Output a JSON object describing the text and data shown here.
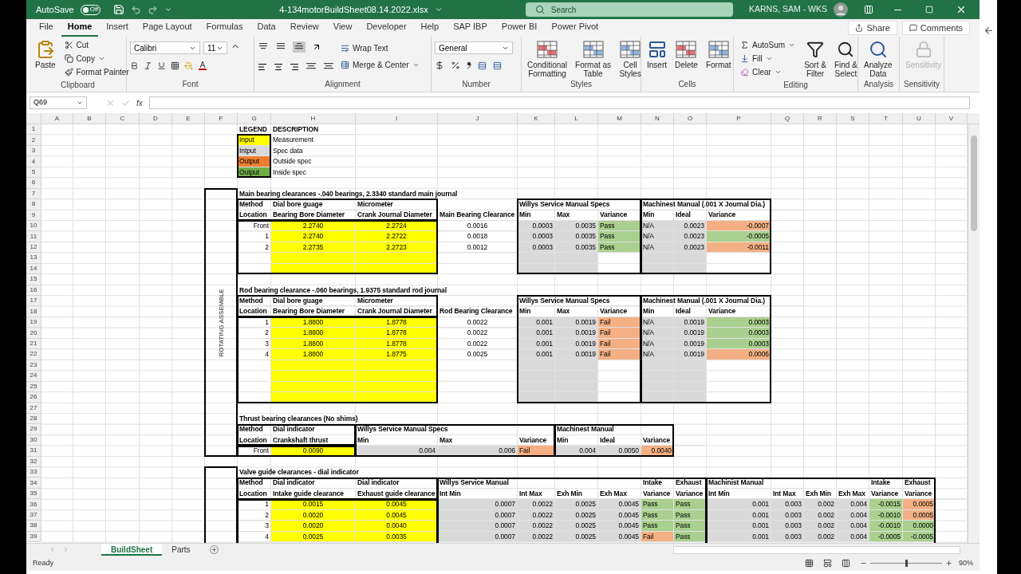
{
  "title_bar": {
    "autosave": {
      "label": "AutoSave",
      "on": false,
      "state_text": "Off"
    },
    "file_name": "4-134motorBuildSheet08.14.2022.xlsx",
    "search": {
      "placeholder": "Search"
    },
    "user": "KARNS, SAM - WKS"
  },
  "tabs": [
    {
      "label": "File",
      "selected": false
    },
    {
      "label": "Home",
      "selected": true
    },
    {
      "label": "Insert",
      "selected": false
    },
    {
      "label": "Page Layout",
      "selected": false
    },
    {
      "label": "Formulas",
      "selected": false
    },
    {
      "label": "Data",
      "selected": false
    },
    {
      "label": "Review",
      "selected": false
    },
    {
      "label": "View",
      "selected": false
    },
    {
      "label": "Developer",
      "selected": false
    },
    {
      "label": "Help",
      "selected": false
    },
    {
      "label": "SAP IBP",
      "selected": false
    },
    {
      "label": "Power BI",
      "selected": false
    },
    {
      "label": "Power Pivot",
      "selected": false
    }
  ],
  "share": "Share",
  "comments": "Comments",
  "ribbon": {
    "clipboard": {
      "label": "Clipboard",
      "paste": "Paste",
      "cut": "Cut",
      "copy": "Copy",
      "format_painter": "Format Painter"
    },
    "font": {
      "label": "Font",
      "font_name": "Calibri",
      "font_size": "11"
    },
    "alignment": {
      "label": "Alignment",
      "wrap_text": "Wrap Text",
      "merge_center": "Merge & Center"
    },
    "number": {
      "label": "Number",
      "format": "General"
    },
    "styles": {
      "label": "Styles",
      "conditional_formatting": "Conditional\nFormatting",
      "format_as_table": "Format as\nTable",
      "cell_styles": "Cell\nStyles"
    },
    "cells": {
      "label": "Cells",
      "insert": "Insert",
      "delete": "Delete",
      "format": "Format"
    },
    "editing": {
      "label": "Editing",
      "autosum": "AutoSum",
      "fill": "Fill",
      "clear": "Clear",
      "sort_filter": "Sort &\nFilter",
      "find_select": "Find &\nSelect"
    },
    "analysis": {
      "label": "Analysis",
      "analyze_data": "Analyze\nData"
    },
    "sensitivity": {
      "label": "Sensitivity",
      "button": {
        "label": "Sensitivity",
        "disabled": true
      }
    }
  },
  "formula_bar": {
    "name_box": "Q69",
    "fx": "fx"
  },
  "sheet": {
    "columns": [
      "A",
      "B",
      "C",
      "D",
      "E",
      "F",
      "G",
      "H",
      "I",
      "J",
      "K",
      "L",
      "M",
      "N",
      "O",
      "P",
      "Q",
      "R",
      "S",
      "T",
      "U",
      "V"
    ],
    "side_label": "ROTATING ASSEMBLE",
    "rows": [
      {
        "num": "1",
        "cells": [
          "",
          "",
          "",
          "",
          "",
          "",
          {
            "text": "LEGEND",
            "bold": true
          },
          {
            "text": "DESCRIPTION",
            "bold": true
          }
        ]
      },
      {
        "num": "2",
        "cells": [
          "",
          "",
          "",
          "",
          "",
          "",
          {
            "text": "Input",
            "color": "#ffff00"
          },
          {
            "text": "Measurement"
          }
        ]
      },
      {
        "num": "3",
        "cells": [
          "",
          "",
          "",
          "",
          "",
          "",
          {
            "text": "Intput",
            "color": "#d9d9d9"
          },
          {
            "text": "Spec data"
          }
        ]
      },
      {
        "num": "4",
        "cells": [
          "",
          "",
          "",
          "",
          "",
          "",
          {
            "text": "Output",
            "color": "#ed7d31"
          },
          {
            "text": "Outside spec"
          }
        ]
      },
      {
        "num": "5",
        "cells": [
          "",
          "",
          "",
          "",
          "",
          "",
          {
            "text": "Output",
            "color": "#70ad47"
          },
          {
            "text": "Inside spec"
          }
        ]
      },
      {
        "num": "6",
        "cells": []
      },
      {
        "num": "7",
        "cells": [
          "",
          "",
          "",
          "",
          "",
          "",
          {
            "text": "Main bearing clearances -.040 bearings, 2.3340 standard main journal",
            "bold": true
          }
        ]
      },
      {
        "num": "8",
        "cells": [
          "",
          "",
          "",
          "",
          "",
          "",
          {
            "text": "Method",
            "bold": true
          },
          {
            "text": "Dial bore guage",
            "bold": true
          },
          {
            "text": "Micrometer",
            "bold": true
          },
          "",
          {
            "text": "Willys Service Manual Specs",
            "bold": true
          },
          "",
          "",
          {
            "text": "Machinest Manual (.001 X Journal Dia.)",
            "bold": true
          }
        ]
      },
      {
        "num": "9",
        "cells": [
          "",
          "",
          "",
          "",
          "",
          "",
          {
            "text": "Location",
            "bold": true
          },
          {
            "text": "Bearing Bore Diameter",
            "bold": true
          },
          {
            "text": "Crank Journal Diameter",
            "bold": true
          },
          {
            "text": "Main Bearing Clearance",
            "bold": true
          },
          {
            "text": "Min",
            "bold": true
          },
          {
            "text": "Max",
            "bold": true
          },
          {
            "text": "Variance",
            "bold": true
          },
          {
            "text": "Min",
            "bold": true
          },
          {
            "text": "Ideal",
            "bold": true
          },
          {
            "text": "Variance",
            "bold": true
          }
        ]
      },
      {
        "num": "10",
        "cells": [
          "",
          "",
          "",
          "",
          "",
          "",
          {
            "text": "Front",
            "kind": "number"
          },
          {
            "text": "2.2740",
            "color": "#ffff00",
            "kind": "input"
          },
          {
            "text": "2.2724",
            "color": "#ffff00",
            "kind": "input"
          },
          {
            "text": "0.0016",
            "kind": "input"
          },
          {
            "text": "0.0003",
            "color": "#d9d9d9",
            "kind": "number"
          },
          {
            "text": "0.0035",
            "color": "#d9d9d9",
            "kind": "number"
          },
          {
            "text": "Pass",
            "color": "#a9d08e"
          },
          {
            "text": "N/A",
            "color": "#d9d9d9"
          },
          {
            "text": "0.0023",
            "color": "#d9d9d9",
            "kind": "number"
          },
          {
            "text": "-0.0007",
            "color": "#f4b084",
            "kind": "number"
          }
        ]
      },
      {
        "num": "11",
        "cells": [
          "",
          "",
          "",
          "",
          "",
          "",
          {
            "text": "1",
            "kind": "number"
          },
          {
            "text": "2.2740",
            "color": "#ffff00",
            "kind": "input"
          },
          {
            "text": "2.2722",
            "color": "#ffff00",
            "kind": "input"
          },
          {
            "text": "0.0018",
            "kind": "input"
          },
          {
            "text": "0.0003",
            "color": "#d9d9d9",
            "kind": "number"
          },
          {
            "text": "0.0035",
            "color": "#d9d9d9",
            "kind": "number"
          },
          {
            "text": "Pass",
            "color": "#a9d08e"
          },
          {
            "text": "N/A",
            "color": "#d9d9d9"
          },
          {
            "text": "0.0023",
            "color": "#d9d9d9",
            "kind": "number"
          },
          {
            "text": "-0.0005",
            "color": "#a9d08e",
            "kind": "number"
          }
        ]
      },
      {
        "num": "12",
        "cells": [
          "",
          "",
          "",
          "",
          "",
          "",
          {
            "text": "2",
            "kind": "number"
          },
          {
            "text": "2.2735",
            "color": "#ffff00",
            "kind": "input"
          },
          {
            "text": "2.2723",
            "color": "#ffff00",
            "kind": "input"
          },
          {
            "text": "0.0012",
            "kind": "input"
          },
          {
            "text": "0.0003",
            "color": "#d9d9d9",
            "kind": "number"
          },
          {
            "text": "0.0035",
            "color": "#d9d9d9",
            "kind": "number"
          },
          {
            "text": "Pass",
            "color": "#a9d08e"
          },
          {
            "text": "N/A",
            "color": "#d9d9d9"
          },
          {
            "text": "0.0023",
            "color": "#d9d9d9",
            "kind": "number"
          },
          {
            "text": "-0.0011",
            "color": "#f4b084",
            "kind": "number"
          }
        ]
      },
      {
        "num": "13",
        "cells": [
          "",
          "",
          "",
          "",
          "",
          "",
          "",
          {
            "color": "#ffff00"
          },
          {
            "color": "#ffff00"
          },
          "",
          {
            "color": "#d9d9d9"
          },
          {
            "color": "#d9d9d9"
          },
          "",
          {
            "color": "#d9d9d9"
          },
          {
            "color": "#d9d9d9"
          }
        ]
      },
      {
        "num": "14",
        "cells": [
          "",
          "",
          "",
          "",
          "",
          "",
          "",
          {
            "color": "#ffff00"
          },
          {
            "color": "#ffff00"
          },
          "",
          {
            "color": "#d9d9d9"
          },
          {
            "color": "#d9d9d9"
          },
          "",
          {
            "color": "#d9d9d9"
          },
          {
            "color": "#d9d9d9"
          }
        ]
      },
      {
        "num": "15",
        "cells": []
      },
      {
        "num": "16",
        "cells": [
          "",
          "",
          "",
          "",
          "",
          "",
          {
            "text": "Rod bearing clearance -.060 bearings, 1.9375 standard rod journal",
            "bold": true
          }
        ]
      },
      {
        "num": "17",
        "cells": [
          "",
          "",
          "",
          "",
          "",
          "",
          {
            "text": "Method",
            "bold": true
          },
          {
            "text": "Dial bore guage",
            "bold": true
          },
          {
            "text": "Micrometer",
            "bold": true
          },
          "",
          {
            "text": "Willys Service Manual Specs",
            "bold": true
          },
          "",
          "",
          {
            "text": "Machinest Manual (.001 X Journal Dia.)",
            "bold": true
          }
        ]
      },
      {
        "num": "18",
        "cells": [
          "",
          "",
          "",
          "",
          "",
          "",
          {
            "text": "Location",
            "bold": true
          },
          {
            "text": "Bearing Bore Diameter",
            "bold": true
          },
          {
            "text": "Crank Journal Diameter",
            "bold": true
          },
          {
            "text": "Rod Bearing Clearance",
            "bold": true
          },
          {
            "text": "Min",
            "bold": true
          },
          {
            "text": "Max",
            "bold": true
          },
          {
            "text": "Variance",
            "bold": true
          },
          {
            "text": "Min",
            "bold": true
          },
          {
            "text": "Ideal",
            "bold": true
          },
          {
            "text": "Variance",
            "bold": true
          }
        ]
      },
      {
        "num": "19",
        "cells": [
          "",
          "",
          "",
          "",
          "",
          "",
          {
            "text": "1",
            "kind": "number"
          },
          {
            "text": "1.8800",
            "color": "#ffff00",
            "kind": "input"
          },
          {
            "text": "1.8778",
            "color": "#ffff00",
            "kind": "input"
          },
          {
            "text": "0.0022",
            "kind": "input"
          },
          {
            "text": "0.001",
            "color": "#d9d9d9",
            "kind": "number"
          },
          {
            "text": "0.0019",
            "color": "#d9d9d9",
            "kind": "number"
          },
          {
            "text": "Fail",
            "color": "#f4b084"
          },
          {
            "text": "N/A",
            "color": "#d9d9d9"
          },
          {
            "text": "0.0019",
            "color": "#d9d9d9",
            "kind": "number"
          },
          {
            "text": "0.0003",
            "color": "#a9d08e",
            "kind": "number"
          }
        ]
      },
      {
        "num": "20",
        "cells": [
          "",
          "",
          "",
          "",
          "",
          "",
          {
            "text": "2",
            "kind": "number"
          },
          {
            "text": "1.8800",
            "color": "#ffff00",
            "kind": "input"
          },
          {
            "text": "1.8778",
            "color": "#ffff00",
            "kind": "input"
          },
          {
            "text": "0.0022",
            "kind": "input"
          },
          {
            "text": "0.001",
            "color": "#d9d9d9",
            "kind": "number"
          },
          {
            "text": "0.0019",
            "color": "#d9d9d9",
            "kind": "number"
          },
          {
            "text": "Fail",
            "color": "#f4b084"
          },
          {
            "text": "N/A",
            "color": "#d9d9d9"
          },
          {
            "text": "0.0019",
            "color": "#d9d9d9",
            "kind": "number"
          },
          {
            "text": "0.0003",
            "color": "#a9d08e",
            "kind": "number"
          }
        ]
      },
      {
        "num": "21",
        "cells": [
          "",
          "",
          "",
          "",
          "",
          "",
          {
            "text": "3",
            "kind": "number"
          },
          {
            "text": "1.8800",
            "color": "#ffff00",
            "kind": "input"
          },
          {
            "text": "1.8778",
            "color": "#ffff00",
            "kind": "input"
          },
          {
            "text": "0.0022",
            "kind": "input"
          },
          {
            "text": "0.001",
            "color": "#d9d9d9",
            "kind": "number"
          },
          {
            "text": "0.0019",
            "color": "#d9d9d9",
            "kind": "number"
          },
          {
            "text": "Fail",
            "color": "#f4b084"
          },
          {
            "text": "N/A",
            "color": "#d9d9d9"
          },
          {
            "text": "0.0019",
            "color": "#d9d9d9",
            "kind": "number"
          },
          {
            "text": "0.0003",
            "color": "#a9d08e",
            "kind": "number"
          }
        ]
      },
      {
        "num": "22",
        "cells": [
          "",
          "",
          "",
          "",
          "",
          "",
          {
            "text": "4",
            "kind": "number"
          },
          {
            "text": "1.8800",
            "color": "#ffff00",
            "kind": "input"
          },
          {
            "text": "1.8775",
            "color": "#ffff00",
            "kind": "input"
          },
          {
            "text": "0.0025",
            "kind": "input"
          },
          {
            "text": "0.001",
            "color": "#d9d9d9",
            "kind": "number"
          },
          {
            "text": "0.0019",
            "color": "#d9d9d9",
            "kind": "number"
          },
          {
            "text": "Fail",
            "color": "#f4b084"
          },
          {
            "text": "N/A",
            "color": "#d9d9d9"
          },
          {
            "text": "0.0019",
            "color": "#d9d9d9",
            "kind": "number"
          },
          {
            "text": "0.0006",
            "color": "#f4b084",
            "kind": "number"
          }
        ]
      },
      {
        "num": "23",
        "cells": [
          "",
          "",
          "",
          "",
          "",
          "",
          "",
          {
            "color": "#ffff00"
          },
          {
            "color": "#ffff00"
          },
          "",
          {
            "color": "#d9d9d9"
          },
          {
            "color": "#d9d9d9"
          },
          "",
          {
            "color": "#d9d9d9"
          },
          {
            "color": "#d9d9d9"
          }
        ]
      },
      {
        "num": "24",
        "cells": [
          "",
          "",
          "",
          "",
          "",
          "",
          "",
          {
            "color": "#ffff00"
          },
          {
            "color": "#ffff00"
          },
          "",
          {
            "color": "#d9d9d9"
          },
          {
            "color": "#d9d9d9"
          },
          "",
          {
            "color": "#d9d9d9"
          },
          {
            "color": "#d9d9d9"
          }
        ]
      },
      {
        "num": "25",
        "cells": [
          "",
          "",
          "",
          "",
          "",
          "",
          "",
          {
            "color": "#ffff00"
          },
          {
            "color": "#ffff00"
          },
          "",
          {
            "color": "#d9d9d9"
          },
          {
            "color": "#d9d9d9"
          },
          "",
          {
            "color": "#d9d9d9"
          },
          {
            "color": "#d9d9d9"
          }
        ]
      },
      {
        "num": "26",
        "cells": [
          "",
          "",
          "",
          "",
          "",
          "",
          "",
          {
            "color": "#ffff00"
          },
          {
            "color": "#ffff00"
          },
          "",
          {
            "color": "#d9d9d9"
          },
          {
            "color": "#d9d9d9"
          },
          "",
          {
            "color": "#d9d9d9"
          },
          {
            "color": "#d9d9d9"
          }
        ]
      },
      {
        "num": "27",
        "cells": []
      },
      {
        "num": "28",
        "cells": [
          "",
          "",
          "",
          "",
          "",
          "",
          {
            "text": "Thrust bearing clearances (No shims)",
            "bold": true
          }
        ]
      },
      {
        "num": "29",
        "cells": [
          "",
          "",
          "",
          "",
          "",
          "",
          {
            "text": "Method",
            "bold": true
          },
          {
            "text": "Dial indicator",
            "bold": true
          },
          {
            "text": "Willys Service Manual Specs",
            "bold": true
          },
          "",
          "",
          {
            "text": "Machinest Manual",
            "bold": true
          }
        ]
      },
      {
        "num": "30",
        "cells": [
          "",
          "",
          "",
          "",
          "",
          "",
          {
            "text": "Location",
            "bold": true
          },
          {
            "text": "Crankshaft thrust",
            "bold": true
          },
          {
            "text": "Min",
            "bold": true
          },
          {
            "text": "Max",
            "bold": true
          },
          {
            "text": "Variance",
            "bold": true
          },
          {
            "text": "Min",
            "bold": true
          },
          {
            "text": "Ideal",
            "bold": true
          },
          {
            "text": "Variance",
            "bold": true
          }
        ]
      },
      {
        "num": "31",
        "cells": [
          "",
          "",
          "",
          "",
          "",
          "",
          {
            "text": "Front",
            "kind": "number"
          },
          {
            "text": "0.0090",
            "color": "#ffff00",
            "kind": "input"
          },
          {
            "text": "0.004",
            "color": "#d9d9d9",
            "kind": "number"
          },
          {
            "text": "0.006",
            "color": "#d9d9d9",
            "kind": "number"
          },
          {
            "text": "Fail",
            "color": "#f4b084"
          },
          {
            "text": "0.004",
            "color": "#d9d9d9",
            "kind": "number"
          },
          {
            "text": "0.0050",
            "color": "#d9d9d9",
            "kind": "number"
          },
          {
            "text": "0.0040",
            "color": "#f4b084",
            "kind": "number"
          }
        ]
      },
      {
        "num": "32",
        "cells": []
      },
      {
        "num": "33",
        "cells": [
          "",
          "",
          "",
          "",
          "",
          "",
          {
            "text": "Valve guide clearances - dial indicator",
            "bold": true
          }
        ]
      },
      {
        "num": "34",
        "cells": [
          "",
          "",
          "",
          "",
          "",
          "",
          {
            "text": "Method",
            "bold": true
          },
          {
            "text": "Dial indicator",
            "bold": true
          },
          {
            "text": "Dial indicator",
            "bold": true
          },
          {
            "text": "Willys Service Manual",
            "bold": true
          },
          "",
          "",
          "",
          {
            "text": "Intake",
            "bold": true
          },
          {
            "text": "Exhaust",
            "bold": true
          },
          {
            "text": "Machinist Manual",
            "bold": true
          },
          "",
          "",
          "",
          {
            "text": "Intake",
            "bold": true
          },
          {
            "text": "Exhaust",
            "bold": true
          }
        ]
      },
      {
        "num": "35",
        "cells": [
          "",
          "",
          "",
          "",
          "",
          "",
          {
            "text": "Location",
            "bold": true
          },
          {
            "text": "Intake guide clearance",
            "bold": true
          },
          {
            "text": "Exhaust guide clearance",
            "bold": true
          },
          {
            "text": "Int Min",
            "bold": true
          },
          {
            "text": "Int Max",
            "bold": true
          },
          {
            "text": "Exh Min",
            "bold": true
          },
          {
            "text": "Exh Max",
            "bold": true
          },
          {
            "text": "Variance",
            "bold": true
          },
          {
            "text": "Variance",
            "bold": true
          },
          {
            "text": "Int Min",
            "bold": true
          },
          {
            "text": "Int Max",
            "bold": true
          },
          {
            "text": "Exh Min",
            "bold": true
          },
          {
            "text": "Exh Max",
            "bold": true
          },
          {
            "text": "Variance",
            "bold": true
          },
          {
            "text": "Variance",
            "bold": true
          }
        ]
      },
      {
        "num": "36",
        "cells": [
          "",
          "",
          "",
          "",
          "",
          "",
          {
            "text": "1",
            "kind": "number"
          },
          {
            "text": "0.0015",
            "color": "#ffff00",
            "kind": "input"
          },
          {
            "text": "0.0045",
            "color": "#ffff00",
            "kind": "input"
          },
          {
            "text": "0.0007",
            "color": "#d9d9d9",
            "kind": "number"
          },
          {
            "text": "0.0022",
            "color": "#d9d9d9",
            "kind": "number"
          },
          {
            "text": "0.0025",
            "color": "#d9d9d9",
            "kind": "number"
          },
          {
            "text": "0.0045",
            "color": "#d9d9d9",
            "kind": "number"
          },
          {
            "text": "Pass",
            "color": "#a9d08e"
          },
          {
            "text": "Pass",
            "color": "#a9d08e"
          },
          {
            "text": "0.001",
            "color": "#d9d9d9",
            "kind": "number"
          },
          {
            "text": "0.003",
            "color": "#d9d9d9",
            "kind": "number"
          },
          {
            "text": "0.002",
            "color": "#d9d9d9",
            "kind": "number"
          },
          {
            "text": "0.004",
            "color": "#d9d9d9",
            "kind": "number"
          },
          {
            "text": "-0.0015",
            "color": "#a9d08e",
            "kind": "number"
          },
          {
            "text": "0.0005",
            "color": "#f4b084",
            "kind": "number"
          }
        ]
      },
      {
        "num": "37",
        "cells": [
          "",
          "",
          "",
          "",
          "",
          "",
          {
            "text": "2",
            "kind": "number"
          },
          {
            "text": "0.0020",
            "color": "#ffff00",
            "kind": "input"
          },
          {
            "text": "0.0045",
            "color": "#ffff00",
            "kind": "input"
          },
          {
            "text": "0.0007",
            "color": "#d9d9d9",
            "kind": "number"
          },
          {
            "text": "0.0022",
            "color": "#d9d9d9",
            "kind": "number"
          },
          {
            "text": "0.0025",
            "color": "#d9d9d9",
            "kind": "number"
          },
          {
            "text": "0.0045",
            "color": "#d9d9d9",
            "kind": "number"
          },
          {
            "text": "Pass",
            "color": "#a9d08e"
          },
          {
            "text": "Pass",
            "color": "#a9d08e"
          },
          {
            "text": "0.001",
            "color": "#d9d9d9",
            "kind": "number"
          },
          {
            "text": "0.003",
            "color": "#d9d9d9",
            "kind": "number"
          },
          {
            "text": "0.002",
            "color": "#d9d9d9",
            "kind": "number"
          },
          {
            "text": "0.004",
            "color": "#d9d9d9",
            "kind": "number"
          },
          {
            "text": "-0.0010",
            "color": "#a9d08e",
            "kind": "number"
          },
          {
            "text": "0.0005",
            "color": "#f4b084",
            "kind": "number"
          }
        ]
      },
      {
        "num": "38",
        "cells": [
          "",
          "",
          "",
          "",
          "",
          "",
          {
            "text": "3",
            "kind": "number"
          },
          {
            "text": "0.0020",
            "color": "#ffff00",
            "kind": "input"
          },
          {
            "text": "0.0040",
            "color": "#ffff00",
            "kind": "input"
          },
          {
            "text": "0.0007",
            "color": "#d9d9d9",
            "kind": "number"
          },
          {
            "text": "0.0022",
            "color": "#d9d9d9",
            "kind": "number"
          },
          {
            "text": "0.0025",
            "color": "#d9d9d9",
            "kind": "number"
          },
          {
            "text": "0.0045",
            "color": "#d9d9d9",
            "kind": "number"
          },
          {
            "text": "Pass",
            "color": "#a9d08e"
          },
          {
            "text": "Pass",
            "color": "#a9d08e"
          },
          {
            "text": "0.001",
            "color": "#d9d9d9",
            "kind": "number"
          },
          {
            "text": "0.003",
            "color": "#d9d9d9",
            "kind": "number"
          },
          {
            "text": "0.002",
            "color": "#d9d9d9",
            "kind": "number"
          },
          {
            "text": "0.004",
            "color": "#d9d9d9",
            "kind": "number"
          },
          {
            "text": "-0.0010",
            "color": "#a9d08e",
            "kind": "number"
          },
          {
            "text": "0.0000",
            "color": "#a9d08e",
            "kind": "number"
          }
        ]
      },
      {
        "num": "39",
        "cells": [
          "",
          "",
          "",
          "",
          "",
          "",
          {
            "text": "4",
            "kind": "number"
          },
          {
            "text": "0.0025",
            "color": "#ffff00",
            "kind": "input"
          },
          {
            "text": "0.0035",
            "color": "#ffff00",
            "kind": "input"
          },
          {
            "text": "0.0007",
            "color": "#d9d9d9",
            "kind": "number"
          },
          {
            "text": "0.0022",
            "color": "#d9d9d9",
            "kind": "number"
          },
          {
            "text": "0.0025",
            "color": "#d9d9d9",
            "kind": "number"
          },
          {
            "text": "0.0045",
            "color": "#d9d9d9",
            "kind": "number"
          },
          {
            "text": "Fail",
            "color": "#f4b084"
          },
          {
            "text": "Pass",
            "color": "#a9d08e"
          },
          {
            "text": "0.001",
            "color": "#d9d9d9",
            "kind": "number"
          },
          {
            "text": "0.003",
            "color": "#d9d9d9",
            "kind": "number"
          },
          {
            "text": "0.002",
            "color": "#d9d9d9",
            "kind": "number"
          },
          {
            "text": "0.004",
            "color": "#d9d9d9",
            "kind": "number"
          },
          {
            "text": "-0.0005",
            "color": "#a9d08e",
            "kind": "number"
          },
          {
            "text": "-0.0005",
            "color": "#a9d08e",
            "kind": "number"
          }
        ]
      }
    ]
  },
  "sheet_tabs": [
    {
      "label": "BuildSheet",
      "selected": true
    },
    {
      "label": "Parts",
      "selected": false
    }
  ],
  "status_bar": {
    "status": "Ready",
    "zoom": {
      "level": 0.5,
      "reading": "90%"
    }
  }
}
